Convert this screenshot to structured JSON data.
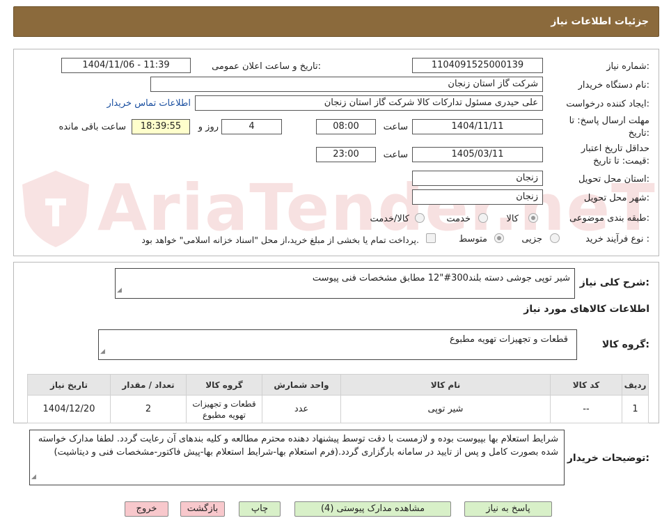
{
  "header": {
    "title": "جزئیات اطلاعات نیاز"
  },
  "watermark": {
    "text": "AriaTender.neT"
  },
  "form": {
    "need_number_label": "شماره نیاز:",
    "need_number": "1104091525000139",
    "announce_label": "تاریخ و ساعت اعلان عمومی:",
    "announce_value": "1404/11/06 - 11:39",
    "buyer_org_label": "نام دستگاه خریدار:",
    "buyer_org": "شرکت گاز استان زنجان",
    "requester_label": "ایجاد کننده درخواست:",
    "requester": "علی حیدری مسئول تدارکات کالا شرکت گاز استان زنجان",
    "contact_link": "اطلاعات تماس خریدار",
    "deadline_label_1": "مهلت ارسال پاسخ: تا",
    "deadline_label_2": "تاریخ:",
    "deadline_date": "1404/11/11",
    "time_label": "ساعت",
    "deadline_time": "08:00",
    "days_value": "4",
    "days_label": "روز و",
    "remaining_time": "18:39:55",
    "remaining_label": "ساعت باقی مانده",
    "validity_label_1": "حداقل تاریخ اعتبار",
    "validity_label_2": "قیمت: تا تاریخ:",
    "validity_date": "1405/03/11",
    "validity_time_label": "ساعت",
    "validity_time": "23:00",
    "province_label": "استان محل تحویل:",
    "province": "زنجان",
    "city_label": "شهر محل تحویل:",
    "city": "زنجان",
    "category_label": "طبقه بندی موضوعی:",
    "category_options": [
      "کالا",
      "خدمت",
      "کالا/خدمت"
    ],
    "category_selected": "کالا",
    "process_label": "نوع فرآیند خرید :",
    "process_options": [
      "جزیی",
      "متوسط"
    ],
    "process_selected": "متوسط",
    "payment_note": "پرداخت تمام یا بخشی از مبلغ خرید،از محل \"اسناد خزانه اسلامی\" خواهد بود."
  },
  "description": {
    "label": "شرح کلی نیاز:",
    "text": "شیر توپی جوشی دسته بلند300#\"12 مطابق مشخصات فنی پیوست"
  },
  "goods": {
    "section_title": "اطلاعات کالاهای مورد نیاز",
    "group_label": "گروه کالا:",
    "group_value": "قطعات و تجهیزات تهویه مطبوع",
    "columns": [
      "ردیف",
      "کد کالا",
      "نام کالا",
      "واحد شمارش",
      "گروه کالا",
      "تعداد / مقدار",
      "تاریخ نیاز"
    ],
    "rows": [
      [
        "1",
        "--",
        "شیر توپی",
        "عدد",
        "قطعات و تجهیزات تهویه مطبوع",
        "2",
        "1404/12/20"
      ]
    ]
  },
  "buyer_notes": {
    "label": "توضیحات خریدار:",
    "text": "شرایط استعلام بها بپیوست بوده و لازمست با دقت توسط پیشنهاد دهنده محترم مطالعه و کلیه بندهای آن رعایت گردد. لطفا مدارک خواسته شده بصورت کامل و پس از تایید در سامانه بارگزاری گردد.(فرم استعلام بها-شرایط استعلام بها-پیش فاکتور-مشخصات فنی و دیتاشیت)"
  },
  "buttons": {
    "reply": "پاسخ به نیاز",
    "attachments": "مشاهده مدارک پیوستی (4)",
    "print": "چاپ",
    "back": "بازگشت",
    "exit": "خروج"
  },
  "colors": {
    "header_bg": "#8b6a3c",
    "button_green": "#d8f0c8",
    "button_pink": "#f8c8cc",
    "link": "#1a4fa0"
  }
}
